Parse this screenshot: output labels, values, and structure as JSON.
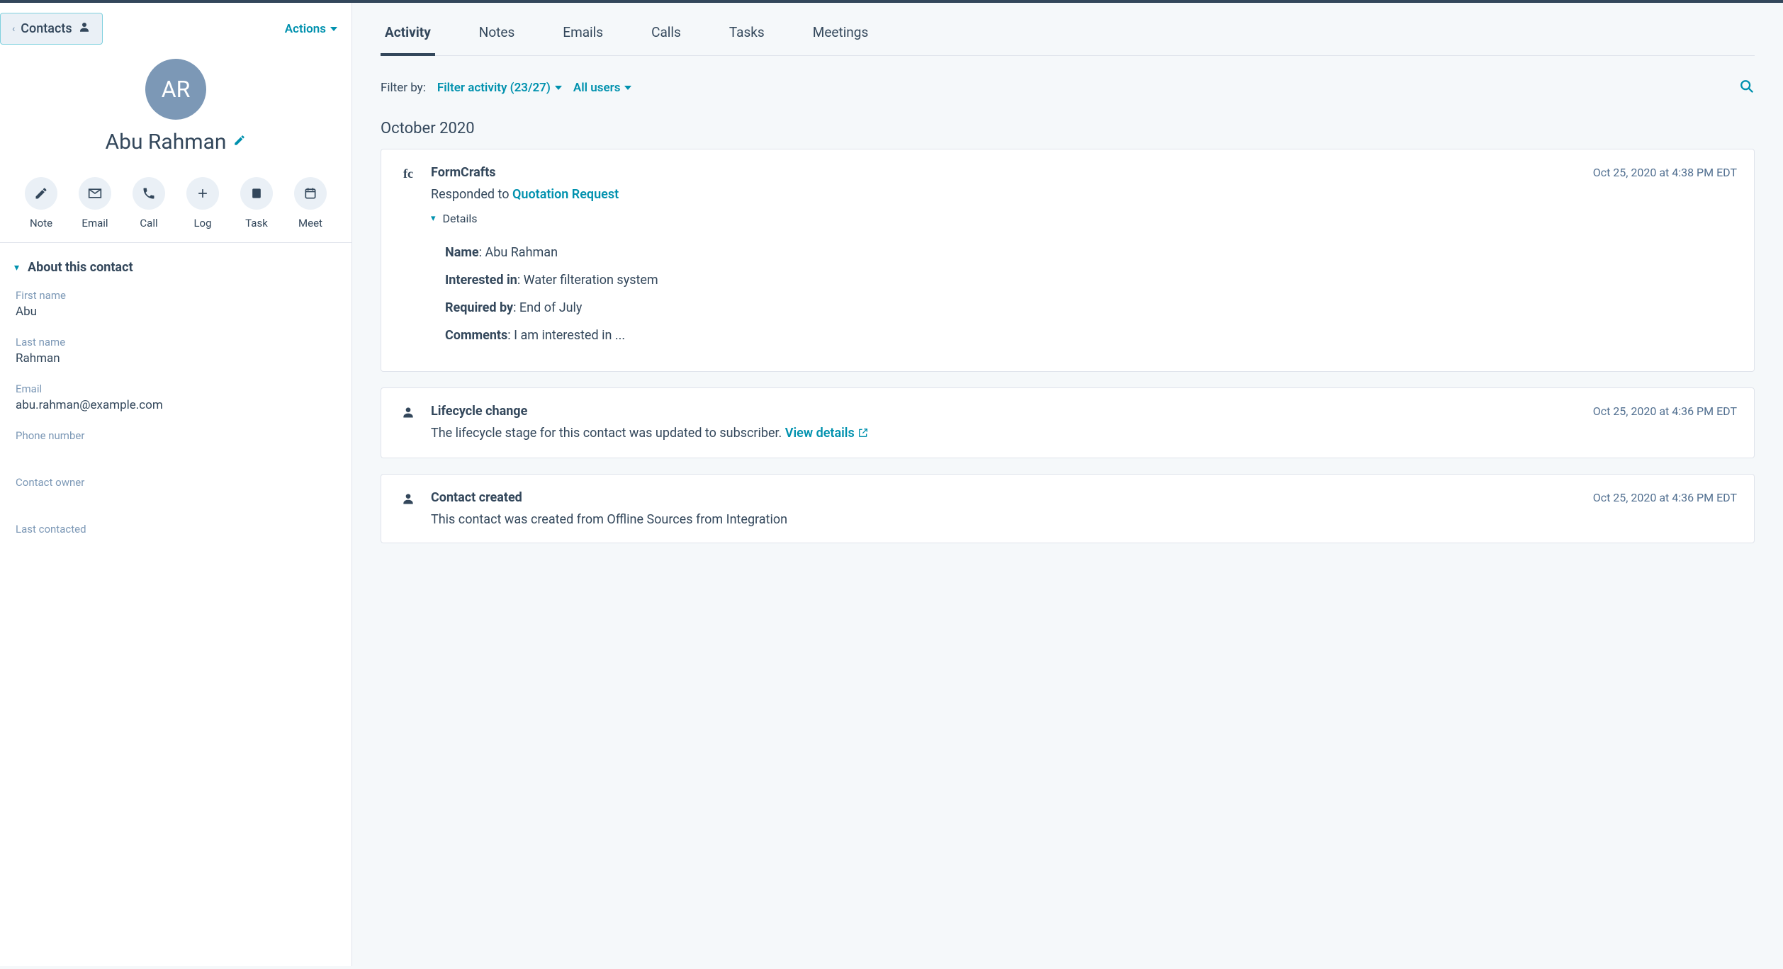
{
  "left": {
    "contacts_label": "Contacts",
    "actions_label": "Actions",
    "avatar_initials": "AR",
    "contact_name": "Abu Rahman",
    "actions": {
      "note": "Note",
      "email": "Email",
      "call": "Call",
      "log": "Log",
      "task": "Task",
      "meet": "Meet"
    },
    "about_section_title": "About this contact",
    "fields": {
      "first_name": {
        "label": "First name",
        "value": "Abu"
      },
      "last_name": {
        "label": "Last name",
        "value": "Rahman"
      },
      "email": {
        "label": "Email",
        "value": "abu.rahman@example.com"
      },
      "phone": {
        "label": "Phone number",
        "value": ""
      },
      "owner": {
        "label": "Contact owner",
        "value": ""
      },
      "last_contacted": {
        "label": "Last contacted",
        "value": ""
      }
    }
  },
  "tabs": {
    "activity": "Activity",
    "notes": "Notes",
    "emails": "Emails",
    "calls": "Calls",
    "tasks": "Tasks",
    "meetings": "Meetings"
  },
  "filter": {
    "label": "Filter by:",
    "activity": "Filter activity (23/27)",
    "users": "All users"
  },
  "timeline": {
    "month": "October 2020",
    "card1": {
      "source": "FormCrafts",
      "time": "Oct 25, 2020 at 4:38 PM EDT",
      "responded_prefix": "Responded to ",
      "responded_link": "Quotation Request",
      "details_label": "Details",
      "details": {
        "name_k": "Name",
        "name_v": ": Abu Rahman",
        "interested_k": "Interested in",
        "interested_v": ": Water filteration system",
        "required_k": "Required by",
        "required_v": ": End of July",
        "comments_k": "Comments",
        "comments_v": ": I am interested in ..."
      }
    },
    "card2": {
      "title": "Lifecycle change",
      "time": "Oct 25, 2020 at 4:36 PM EDT",
      "text": "The lifecycle stage for this contact was updated to subscriber. ",
      "view_details": "View details"
    },
    "card3": {
      "title": "Contact created",
      "time": "Oct 25, 2020 at 4:36 PM EDT",
      "text": "This contact was created from Offline Sources from Integration"
    }
  }
}
